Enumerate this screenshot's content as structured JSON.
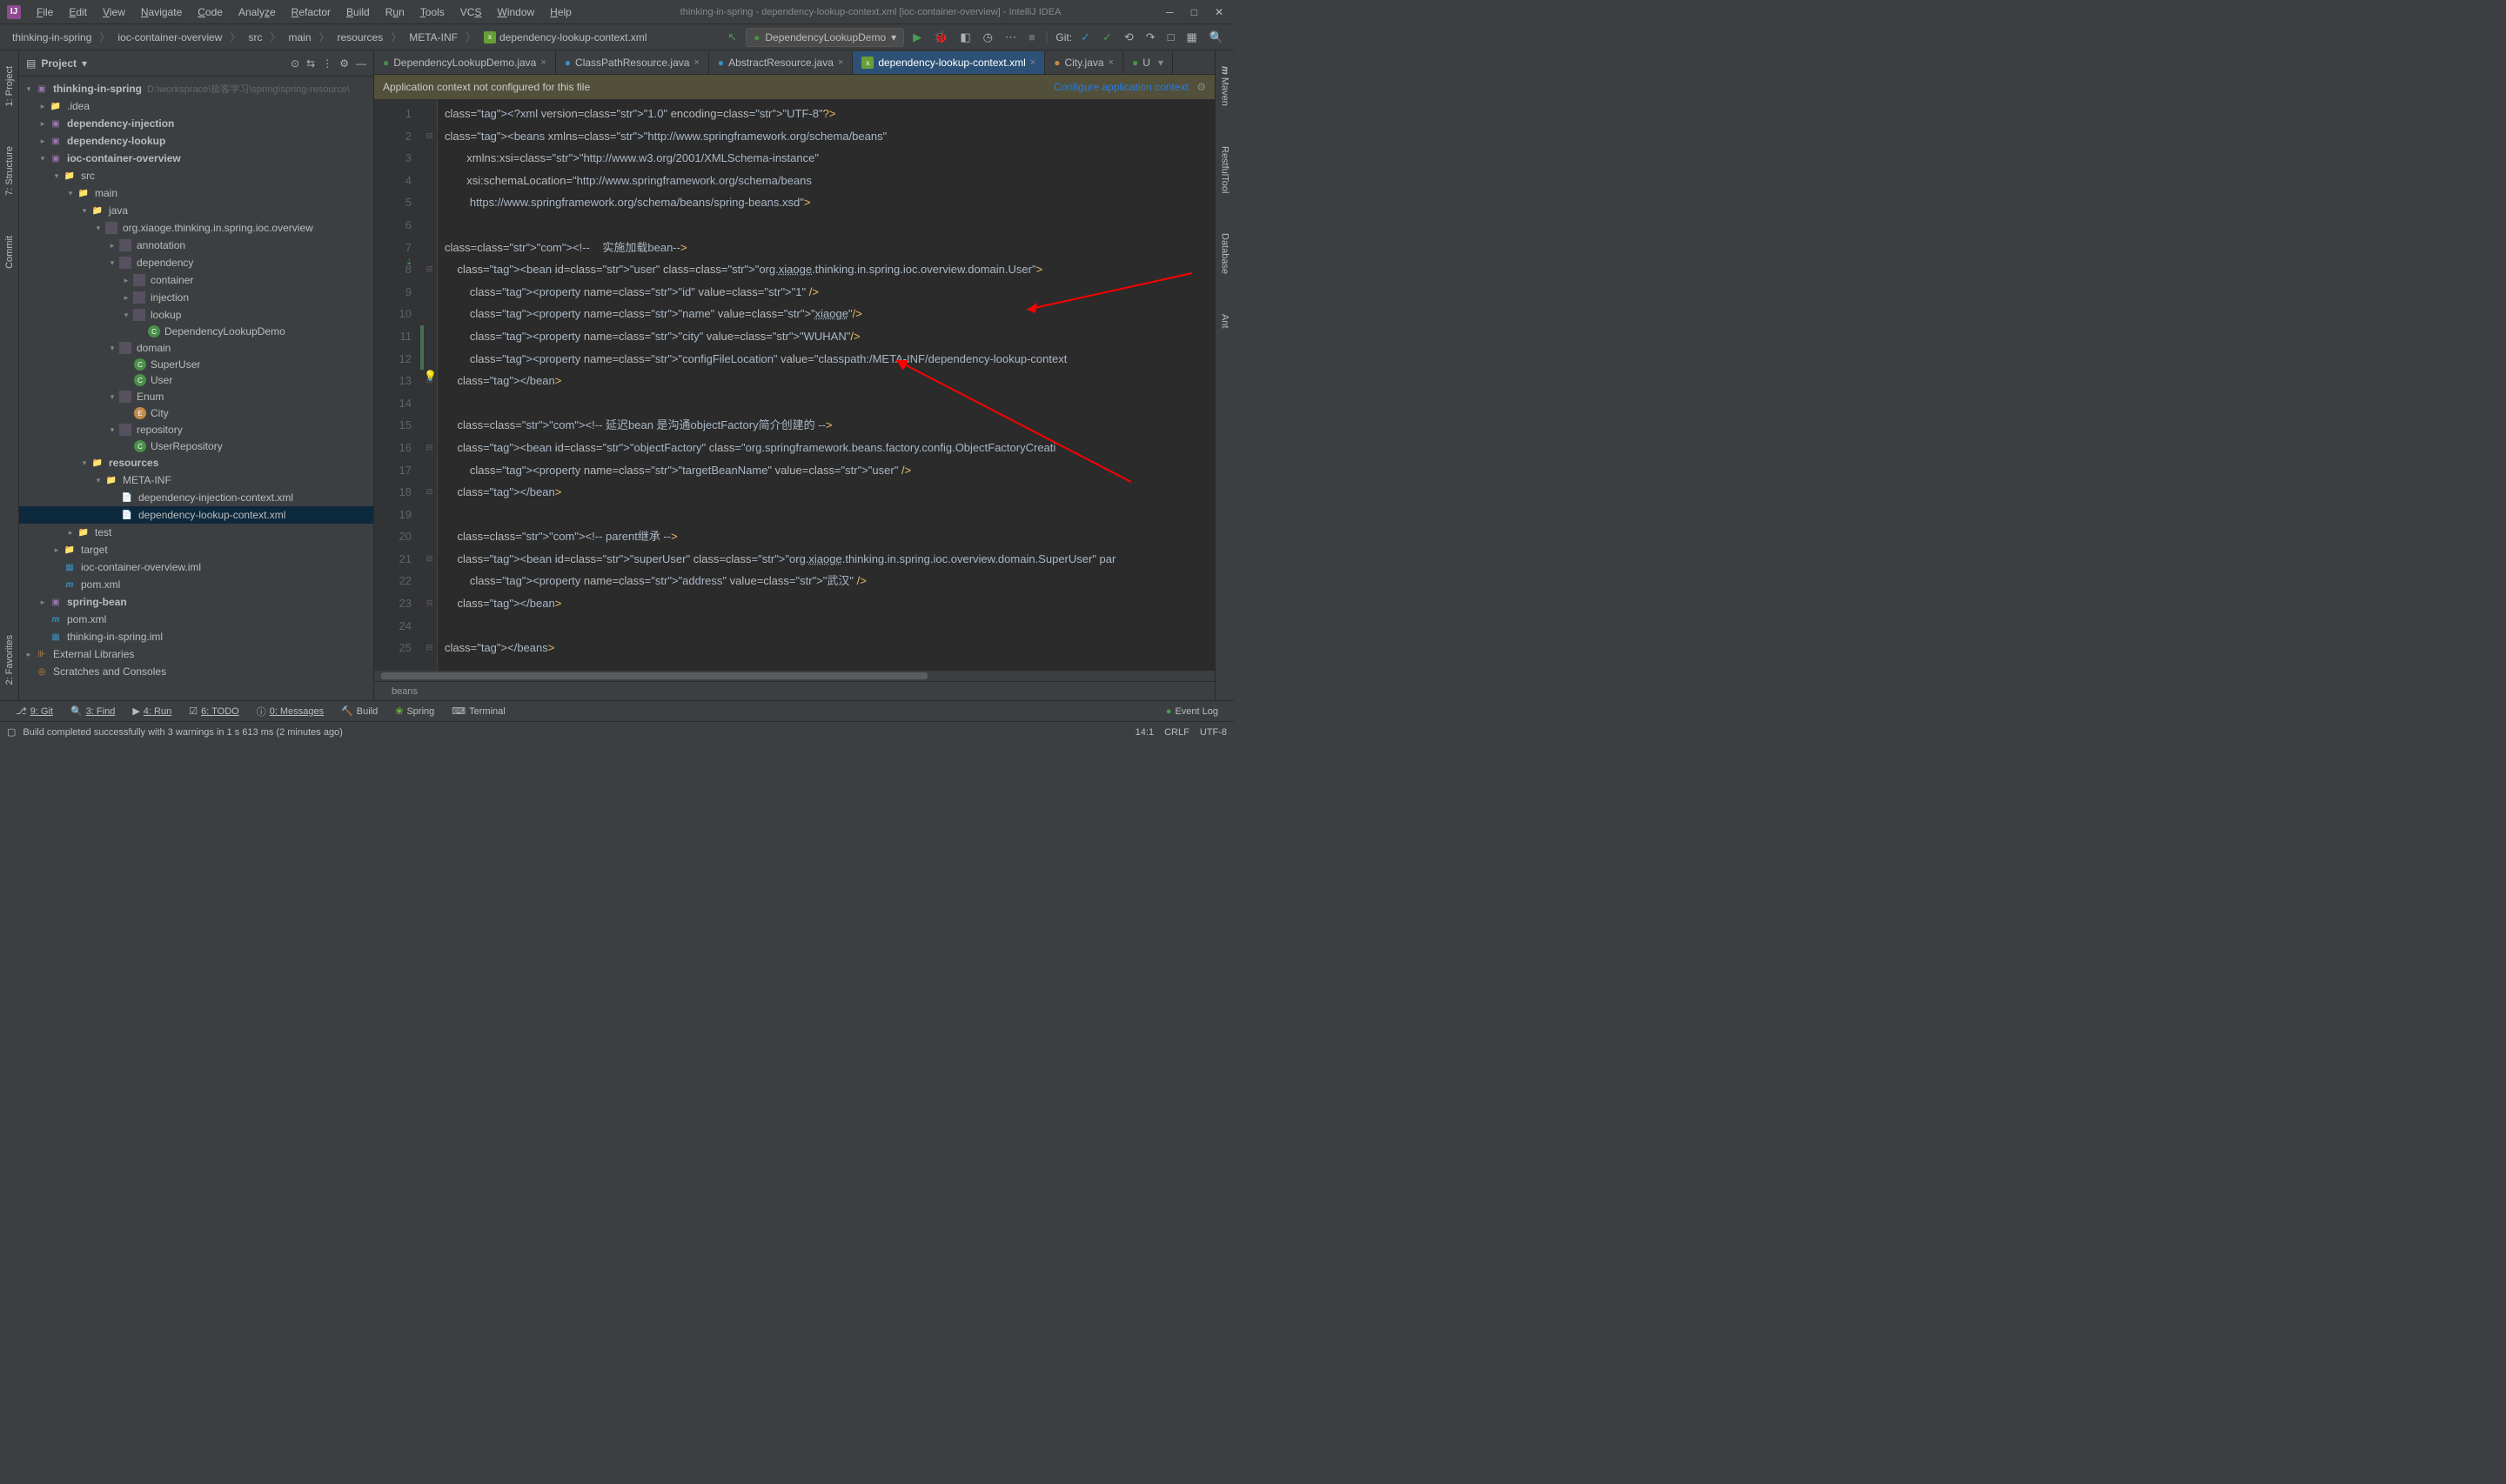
{
  "title_bar": {
    "center": "thinking-in-spring - dependency-lookup-context.xml [ioc-container-overview] - IntelliJ IDEA"
  },
  "menu": [
    "File",
    "Edit",
    "View",
    "Navigate",
    "Code",
    "Analyze",
    "Refactor",
    "Build",
    "Run",
    "Tools",
    "VCS",
    "Window",
    "Help"
  ],
  "breadcrumb": [
    "thinking-in-spring",
    "ioc-container-overview",
    "src",
    "main",
    "resources",
    "META-INF",
    "dependency-lookup-context.xml"
  ],
  "run_config": "DependencyLookupDemo",
  "git_label": "Git:",
  "project_panel_title": "Project",
  "tree": {
    "root": "thinking-in-spring",
    "root_path": "D:\\worksprace\\极客学习\\spring\\spring-resource\\",
    "idea": ".idea",
    "di": "dependency-injection",
    "dl": "dependency-lookup",
    "ioc": "ioc-container-overview",
    "src": "src",
    "main": "main",
    "java": "java",
    "pkg": "org.xiaoge.thinking.in.spring.ioc.overview",
    "annotation": "annotation",
    "dependency": "dependency",
    "container": "container",
    "injection": "injection",
    "lookup": "lookup",
    "demo": "DependencyLookupDemo",
    "domain": "domain",
    "superuser": "SuperUser",
    "user": "User",
    "enum": "Enum",
    "city": "City",
    "repository": "repository",
    "userrepo": "UserRepository",
    "resources": "resources",
    "metainf": "META-INF",
    "dixml": "dependency-injection-context.xml",
    "dlxml": "dependency-lookup-context.xml",
    "test": "test",
    "target": "target",
    "iml": "ioc-container-overview.iml",
    "pom": "pom.xml",
    "springbean": "spring-bean",
    "pom2": "pom.xml",
    "tspiml": "thinking-in-spring.iml",
    "extlib": "External Libraries",
    "scratches": "Scratches and Consoles"
  },
  "tabs": [
    {
      "label": "DependencyLookupDemo.java"
    },
    {
      "label": "ClassPathResource.java"
    },
    {
      "label": "AbstractResource.java"
    },
    {
      "label": "dependency-lookup-context.xml"
    },
    {
      "label": "City.java"
    },
    {
      "label": "U"
    }
  ],
  "notice": {
    "text": "Application context not configured for this file",
    "action": "Configure application context"
  },
  "code_lines": [
    "<?xml version=\"1.0\" encoding=\"UTF-8\"?>",
    "<beans xmlns=\"http://www.springframework.org/schema/beans\"",
    "       xmlns:xsi=\"http://www.w3.org/2001/XMLSchema-instance\"",
    "       xsi:schemaLocation=\"http://www.springframework.org/schema/beans",
    "        https://www.springframework.org/schema/beans/spring-beans.xsd\">",
    "",
    "<!--    实施加载bean-->",
    "    <bean id=\"user\" class=\"org.xiaoge.thinking.in.spring.ioc.overview.domain.User\">",
    "        <property name=\"id\" value=\"1\" />",
    "        <property name=\"name\" value=\"xiaoge\"/>",
    "        <property name=\"city\" value=\"WUHAN\"/>",
    "        <property name=\"configFileLocation\" value=\"classpath:/META-INF/dependency-lookup-context",
    "    </bean>",
    "",
    "    <!-- 延迟bean 是沟通objectFactory简介创建的 -->",
    "    <bean id=\"objectFactory\" class=\"org.springframework.beans.factory.config.ObjectFactoryCreati",
    "        <property name=\"targetBeanName\" value=\"user\" />",
    "    </bean>",
    "",
    "    <!-- parent继承 -->",
    "    <bean id=\"superUser\" class=\"org.xiaoge.thinking.in.spring.ioc.overview.domain.SuperUser\" par",
    "        <property name=\"address\" value=\"武汉\" />",
    "    </bean>",
    "",
    "</beans>"
  ],
  "editor_footer_tab": "beans",
  "bottom_tools": {
    "git": "9: Git",
    "find": "3: Find",
    "run": "4: Run",
    "todo": "6: TODO",
    "messages": "0: Messages",
    "build": "Build",
    "spring": "Spring",
    "terminal": "Terminal",
    "event": "Event Log"
  },
  "status": {
    "msg": "Build completed successfully with 3 warnings in 1 s 613 ms (2 minutes ago)",
    "pos": "14:1",
    "eol": "CRLF",
    "enc": "UTF-8"
  },
  "left_tabs": [
    "1: Project",
    "7: Structure",
    "Commit",
    "2: Favorites"
  ],
  "right_tabs": [
    "Maven",
    "RestfulTool",
    "Database",
    "Ant"
  ]
}
